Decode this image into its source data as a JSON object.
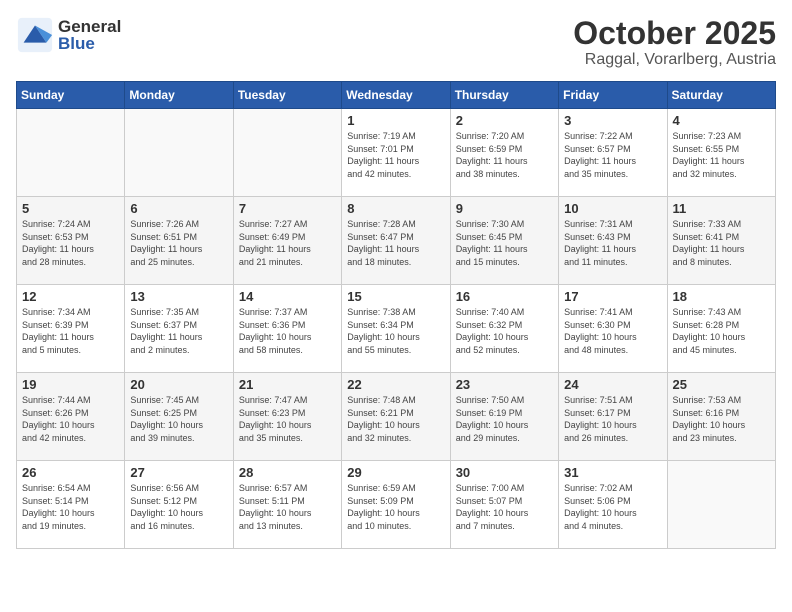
{
  "header": {
    "logo_general": "General",
    "logo_blue": "Blue",
    "month_title": "October 2025",
    "location": "Raggal, Vorarlberg, Austria"
  },
  "calendar": {
    "headers": [
      "Sunday",
      "Monday",
      "Tuesday",
      "Wednesday",
      "Thursday",
      "Friday",
      "Saturday"
    ],
    "weeks": [
      [
        {
          "day": "",
          "info": ""
        },
        {
          "day": "",
          "info": ""
        },
        {
          "day": "",
          "info": ""
        },
        {
          "day": "1",
          "info": "Sunrise: 7:19 AM\nSunset: 7:01 PM\nDaylight: 11 hours\nand 42 minutes."
        },
        {
          "day": "2",
          "info": "Sunrise: 7:20 AM\nSunset: 6:59 PM\nDaylight: 11 hours\nand 38 minutes."
        },
        {
          "day": "3",
          "info": "Sunrise: 7:22 AM\nSunset: 6:57 PM\nDaylight: 11 hours\nand 35 minutes."
        },
        {
          "day": "4",
          "info": "Sunrise: 7:23 AM\nSunset: 6:55 PM\nDaylight: 11 hours\nand 32 minutes."
        }
      ],
      [
        {
          "day": "5",
          "info": "Sunrise: 7:24 AM\nSunset: 6:53 PM\nDaylight: 11 hours\nand 28 minutes."
        },
        {
          "day": "6",
          "info": "Sunrise: 7:26 AM\nSunset: 6:51 PM\nDaylight: 11 hours\nand 25 minutes."
        },
        {
          "day": "7",
          "info": "Sunrise: 7:27 AM\nSunset: 6:49 PM\nDaylight: 11 hours\nand 21 minutes."
        },
        {
          "day": "8",
          "info": "Sunrise: 7:28 AM\nSunset: 6:47 PM\nDaylight: 11 hours\nand 18 minutes."
        },
        {
          "day": "9",
          "info": "Sunrise: 7:30 AM\nSunset: 6:45 PM\nDaylight: 11 hours\nand 15 minutes."
        },
        {
          "day": "10",
          "info": "Sunrise: 7:31 AM\nSunset: 6:43 PM\nDaylight: 11 hours\nand 11 minutes."
        },
        {
          "day": "11",
          "info": "Sunrise: 7:33 AM\nSunset: 6:41 PM\nDaylight: 11 hours\nand 8 minutes."
        }
      ],
      [
        {
          "day": "12",
          "info": "Sunrise: 7:34 AM\nSunset: 6:39 PM\nDaylight: 11 hours\nand 5 minutes."
        },
        {
          "day": "13",
          "info": "Sunrise: 7:35 AM\nSunset: 6:37 PM\nDaylight: 11 hours\nand 2 minutes."
        },
        {
          "day": "14",
          "info": "Sunrise: 7:37 AM\nSunset: 6:36 PM\nDaylight: 10 hours\nand 58 minutes."
        },
        {
          "day": "15",
          "info": "Sunrise: 7:38 AM\nSunset: 6:34 PM\nDaylight: 10 hours\nand 55 minutes."
        },
        {
          "day": "16",
          "info": "Sunrise: 7:40 AM\nSunset: 6:32 PM\nDaylight: 10 hours\nand 52 minutes."
        },
        {
          "day": "17",
          "info": "Sunrise: 7:41 AM\nSunset: 6:30 PM\nDaylight: 10 hours\nand 48 minutes."
        },
        {
          "day": "18",
          "info": "Sunrise: 7:43 AM\nSunset: 6:28 PM\nDaylight: 10 hours\nand 45 minutes."
        }
      ],
      [
        {
          "day": "19",
          "info": "Sunrise: 7:44 AM\nSunset: 6:26 PM\nDaylight: 10 hours\nand 42 minutes."
        },
        {
          "day": "20",
          "info": "Sunrise: 7:45 AM\nSunset: 6:25 PM\nDaylight: 10 hours\nand 39 minutes."
        },
        {
          "day": "21",
          "info": "Sunrise: 7:47 AM\nSunset: 6:23 PM\nDaylight: 10 hours\nand 35 minutes."
        },
        {
          "day": "22",
          "info": "Sunrise: 7:48 AM\nSunset: 6:21 PM\nDaylight: 10 hours\nand 32 minutes."
        },
        {
          "day": "23",
          "info": "Sunrise: 7:50 AM\nSunset: 6:19 PM\nDaylight: 10 hours\nand 29 minutes."
        },
        {
          "day": "24",
          "info": "Sunrise: 7:51 AM\nSunset: 6:17 PM\nDaylight: 10 hours\nand 26 minutes."
        },
        {
          "day": "25",
          "info": "Sunrise: 7:53 AM\nSunset: 6:16 PM\nDaylight: 10 hours\nand 23 minutes."
        }
      ],
      [
        {
          "day": "26",
          "info": "Sunrise: 6:54 AM\nSunset: 5:14 PM\nDaylight: 10 hours\nand 19 minutes."
        },
        {
          "day": "27",
          "info": "Sunrise: 6:56 AM\nSunset: 5:12 PM\nDaylight: 10 hours\nand 16 minutes."
        },
        {
          "day": "28",
          "info": "Sunrise: 6:57 AM\nSunset: 5:11 PM\nDaylight: 10 hours\nand 13 minutes."
        },
        {
          "day": "29",
          "info": "Sunrise: 6:59 AM\nSunset: 5:09 PM\nDaylight: 10 hours\nand 10 minutes."
        },
        {
          "day": "30",
          "info": "Sunrise: 7:00 AM\nSunset: 5:07 PM\nDaylight: 10 hours\nand 7 minutes."
        },
        {
          "day": "31",
          "info": "Sunrise: 7:02 AM\nSunset: 5:06 PM\nDaylight: 10 hours\nand 4 minutes."
        },
        {
          "day": "",
          "info": ""
        }
      ]
    ]
  }
}
